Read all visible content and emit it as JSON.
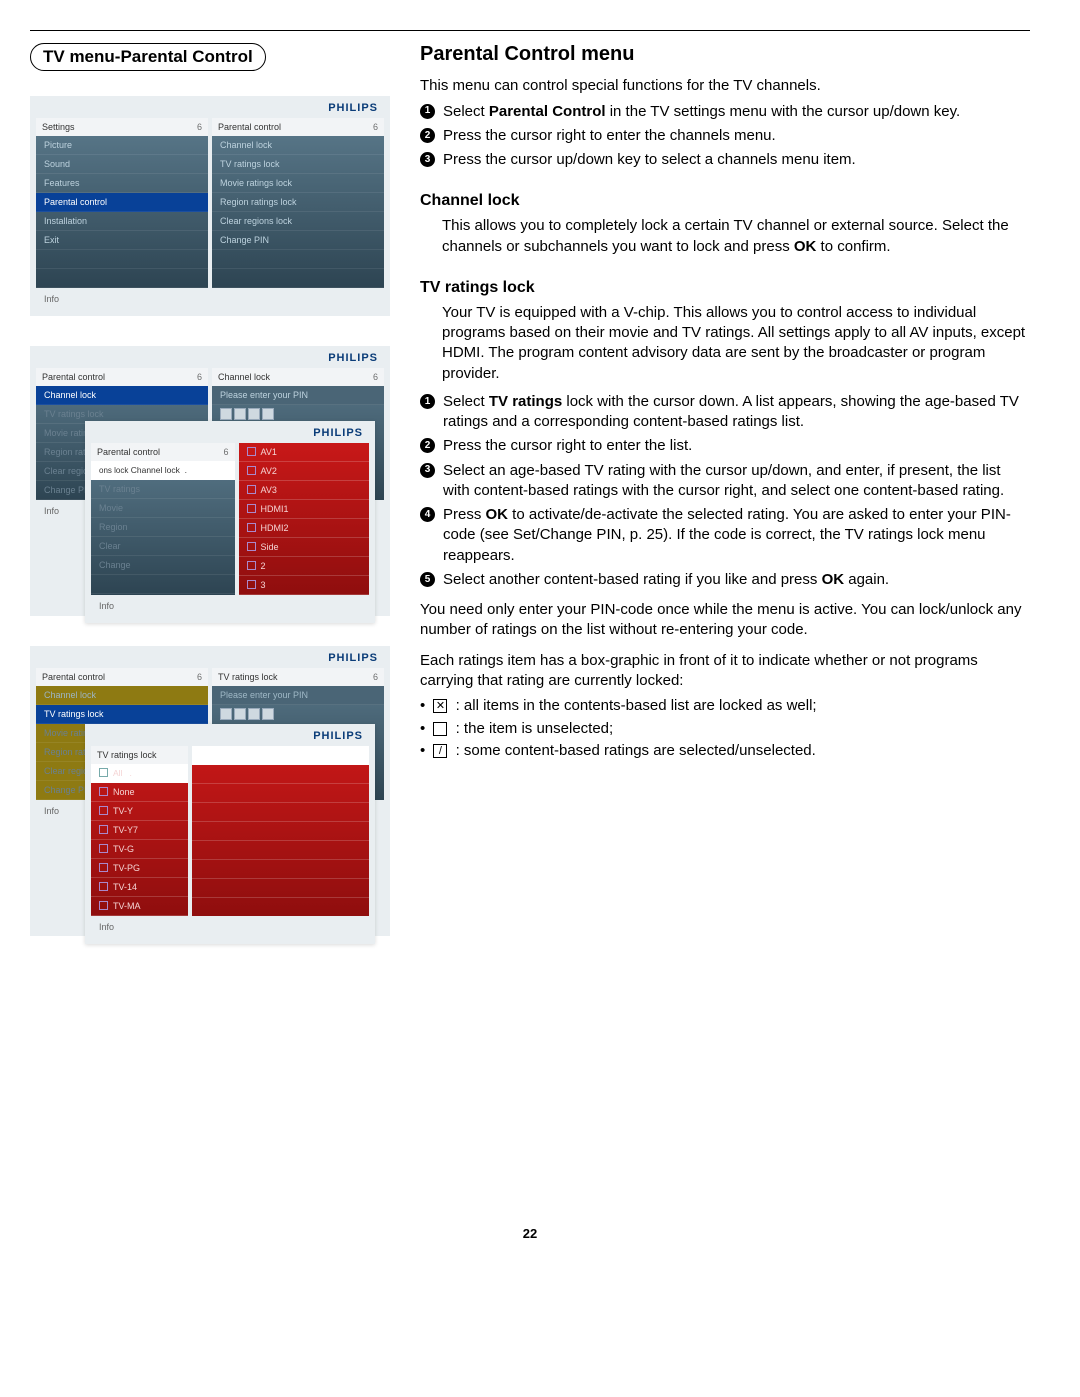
{
  "chapter_title": "TV menu-Parental Control",
  "main_heading": "Parental Control menu",
  "intro": "This menu can control special functions for the TV channels.",
  "steps_intro": [
    "Select <b>Parental Control</b> in the TV settings menu with the cursor up/down key.",
    "Press the cursor right to enter the channels menu.",
    "Press the cursor up/down key to select a channels menu item."
  ],
  "channel_lock_heading": "Channel lock",
  "channel_lock_text": "This allows you to completely lock a certain TV channel or external source. Select the channels or subchannels you want to lock and press <b>OK</b> to confirm.",
  "tv_ratings_heading": "TV ratings lock",
  "tv_ratings_text": "Your TV is equipped with a V-chip. This allows you to control access to individual programs based on their movie and TV ratings. All settings apply to all AV inputs, except HDMI. The program content advisory data are sent by the broadcaster or program provider.",
  "tv_ratings_steps": [
    "Select <b>TV ratings</b> lock with the cursor down. A list appears, showing the age-based TV ratings and a corresponding content-based ratings list.",
    "Press the cursor right to enter the list.",
    "Select an age-based TV rating with the cursor up/down, and enter, if present, the list with content-based ratings with the cursor right, and select one content-based rating.",
    "Press <b>OK</b> to activate/de-activate the selected rating. You are asked to enter your PIN-code (see Set/Change PIN, p. 25). If the code is correct, the TV ratings lock menu reappears.",
    "Select another content-based rating if you like and press <b>OK</b> again."
  ],
  "tv_ratings_after1": "You need only enter your PIN-code once while the menu is active. You can lock/unlock any number of ratings on the list without re-entering your code.",
  "tv_ratings_after2": "Each ratings item has a box-graphic in front of it to indicate whether or not programs carrying that rating are currently locked:",
  "bullet_x": ": all items in the contents-based list are locked as well;",
  "bullet_empty": ": the item is unselected;",
  "bullet_slash": ": some content-based ratings are selected/unselected.",
  "page_number": "22",
  "brand": "PHILIPS",
  "shot1": {
    "left_title": "Settings",
    "left_items": [
      "Picture",
      "Sound",
      "Features",
      "Parental control",
      "Installation",
      "Exit"
    ],
    "left_hl_index": 3,
    "right_title": "Parental control",
    "right_items": [
      "Channel lock",
      "TV ratings lock",
      "Movie ratings lock",
      "Region ratings lock",
      "Clear regions lock",
      "Change PIN"
    ],
    "info": "Info"
  },
  "shot2": {
    "base_left_title": "Parental control",
    "base_left_items": [
      "Channel lock",
      "TV ratings lock",
      "Movie ratings lock",
      "Region ratings lock",
      "Clear regions lock",
      "Change PIN"
    ],
    "base_left_hl": 0,
    "base_right_title": "Channel lock",
    "base_right_label": "Please enter your PIN",
    "overlay_left_title": "Parental control",
    "overlay_left_sub": "Channel lock",
    "overlay_right_items": [
      "AV1",
      "AV2",
      "AV3",
      "HDMI1",
      "HDMI2",
      "Side",
      "2",
      "3"
    ],
    "info": "Info"
  },
  "shot3": {
    "base_left_title": "Parental control",
    "base_left_items": [
      "Channel lock",
      "TV ratings lock",
      "Movie ratings lock",
      "Region ratings lock",
      "Clear regions lock",
      "Change PIN"
    ],
    "base_right_title": "TV ratings lock",
    "base_right_label": "Please enter your PIN",
    "overlay_left_title": "TV ratings lock",
    "overlay_right_items": [
      "All",
      "None",
      "TV-Y",
      "TV-Y7",
      "TV-G",
      "TV-PG",
      "TV-14",
      "TV-MA"
    ],
    "info": "Info"
  }
}
